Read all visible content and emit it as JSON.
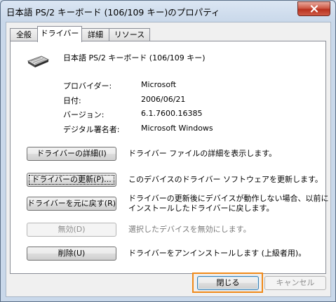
{
  "window": {
    "title": "日本語 PS/2 キーボード (106/109 キー)のプロパティ"
  },
  "tabs": [
    {
      "label": "全般"
    },
    {
      "label": "ドライバー"
    },
    {
      "label": "詳細"
    },
    {
      "label": "リソース"
    }
  ],
  "device": {
    "name": "日本語 PS/2 キーボード (106/109 キー)",
    "icon": "keyboard-icon"
  },
  "properties": [
    {
      "label": "プロバイダー:",
      "value": "Microsoft"
    },
    {
      "label": "日付:",
      "value": "2006/06/21"
    },
    {
      "label": "バージョン:",
      "value": "6.1.7600.16385"
    },
    {
      "label": "デジタル署名者:",
      "value": "Microsoft Windows"
    }
  ],
  "actions": [
    {
      "button": "ドライバーの詳細(I)",
      "description": "ドライバー ファイルの詳細を表示します。"
    },
    {
      "button": "ドライバーの更新(P)...",
      "description": "このデバイスのドライバー ソフトウェアを更新します。"
    },
    {
      "button": "ドライバーを元に戻す(R)",
      "description_line1": "ドライバーの更新後にデバイスが動作しない場合、以前に",
      "description_line2": "インストールしたドライバーに戻します。"
    },
    {
      "button": "無効(D)",
      "description": "選択したデバイスを無効にします。"
    },
    {
      "button": "削除(U)",
      "description": "ドライバーをアンインストールします (上級者用)。"
    }
  ],
  "footer": {
    "close_label": "閉じる",
    "cancel_label": "キャンセル"
  },
  "colors": {
    "highlight": "#f08a1a",
    "close_button": "#c8412d"
  }
}
